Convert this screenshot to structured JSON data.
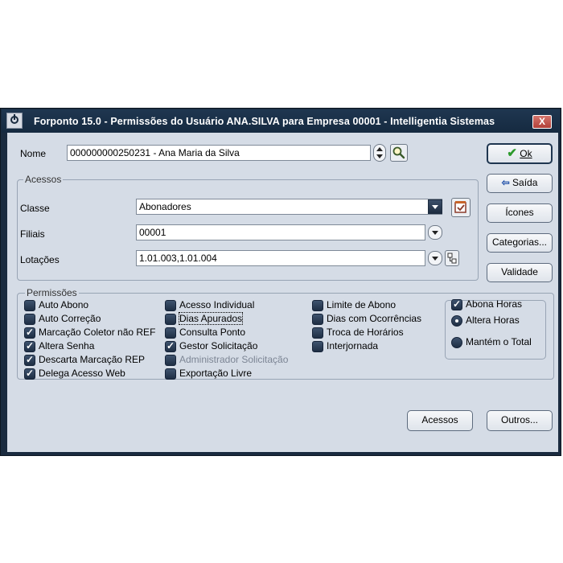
{
  "window": {
    "title": "Forponto 15.0 - Permissões do Usuário ANA.SILVA para Empresa 00001 - Intelligentia Sistemas",
    "close_label": "X"
  },
  "nome": {
    "label": "Nome",
    "value": "000000000250231 - Ana Maria da Silva"
  },
  "acessos_group": {
    "title": "Acessos",
    "classe": {
      "label": "Classe",
      "value": "Abonadores"
    },
    "filiais": {
      "label": "Filiais",
      "value": "00001"
    },
    "lotacoes": {
      "label": "Lotações",
      "value": "1.01.003,1.01.004"
    }
  },
  "buttons": {
    "ok": "Ok",
    "saida": "Saída",
    "icones": "Ícones",
    "categorias": "Categorias...",
    "validade": "Validade",
    "acessos": "Acessos",
    "outros": "Outros..."
  },
  "permissoes": {
    "title": "Permissões",
    "col1": [
      {
        "label": "Auto Abono",
        "checked": false
      },
      {
        "label": "Auto Correção",
        "checked": false
      },
      {
        "label": "Marcação Coletor não REF",
        "checked": true
      },
      {
        "label": "Altera Senha",
        "checked": true
      },
      {
        "label": "Descarta Marcação REP",
        "checked": true
      },
      {
        "label": "Delega Acesso Web",
        "checked": true
      }
    ],
    "col2": [
      {
        "label": "Acesso  Individual",
        "checked": false
      },
      {
        "label": "Dias Apurados",
        "checked": false
      },
      {
        "label": "Consulta Ponto",
        "checked": false
      },
      {
        "label": "Gestor Solicitação",
        "checked": true
      },
      {
        "label": "Administrador Solicitação",
        "checked": false,
        "disabled": true
      },
      {
        "label": "Exportação Livre",
        "checked": false
      }
    ],
    "col3": [
      {
        "label": "Limite de Abono",
        "checked": false
      },
      {
        "label": "Dias com Ocorrências",
        "checked": false
      },
      {
        "label": "Troca de Horários",
        "checked": false
      },
      {
        "label": "Interjornada",
        "checked": false
      }
    ],
    "abona": {
      "checkbox_label": "Abona Horas",
      "checked": true,
      "radio1": "Altera Horas",
      "radio2": "Mantém o Total",
      "selected": "Altera Horas"
    }
  },
  "colors": {
    "titlebar": "#1f3650",
    "client_bg": "#d5dce6",
    "checkbox": "#2c3e56"
  },
  "icons": {
    "app": "forponto-app-icon",
    "search": "magnifier-icon",
    "classe_side": "checklist-icon",
    "lotacoes_side": "tree-icon",
    "ok": "green-check-icon",
    "saida": "exit-arrow-icon"
  }
}
